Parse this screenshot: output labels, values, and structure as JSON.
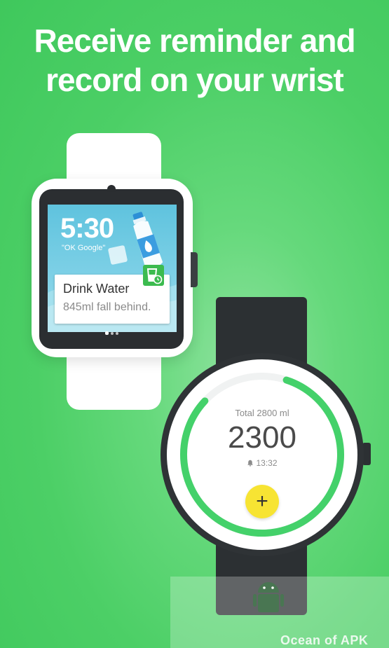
{
  "headline": {
    "line1": "Receive reminder and",
    "line2": "record on your wrist"
  },
  "square_watch": {
    "time": "5:30",
    "voice_hint": "\"OK Google\"",
    "notification": {
      "title": "Drink Water",
      "subtitle": "845ml fall behind.",
      "app_icon": "water-glass-clock-icon"
    }
  },
  "round_watch": {
    "total_label": "Total 2800 ml",
    "current_value": "2300",
    "next_reminder": "13:32",
    "progress": 0.82,
    "add_button_icon": "plus-icon"
  },
  "watermark": {
    "text": "Ocean of APK",
    "logo_icon": "android-apk-icon"
  },
  "colors": {
    "background": "#4ccf66",
    "ring": "#44d16a",
    "add_button": "#f7e433"
  }
}
